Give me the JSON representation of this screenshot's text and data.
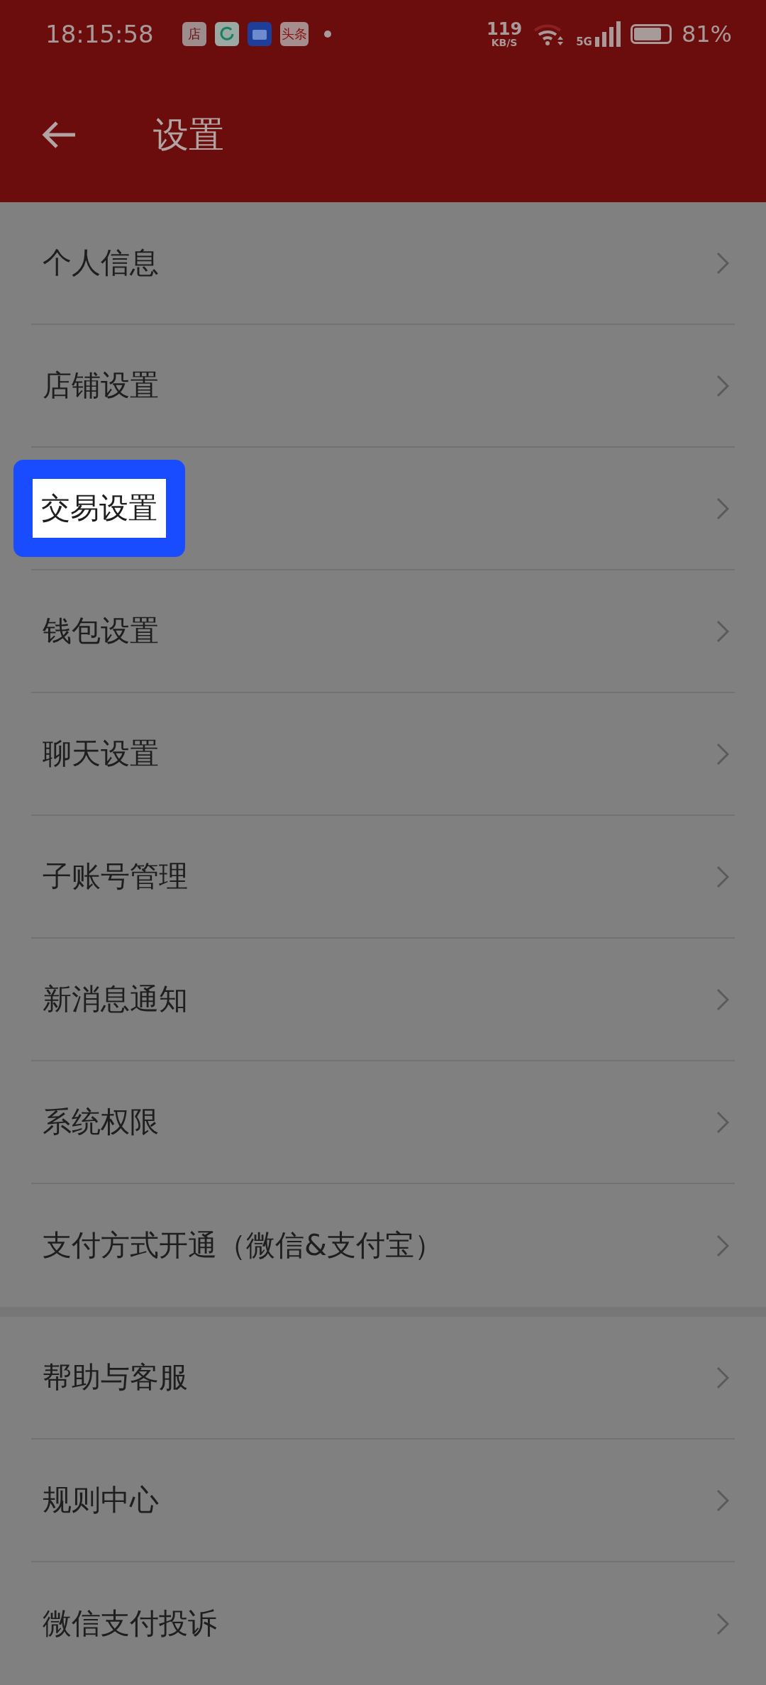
{
  "status_bar": {
    "time": "18:15:58",
    "app_badges": [
      {
        "label": "店",
        "kind": "shop"
      },
      {
        "kind": "refresh"
      },
      {
        "kind": "folder"
      },
      {
        "label": "头条",
        "kind": "news"
      }
    ],
    "speed": "119",
    "speed_unit": "KB/S",
    "network": "5G",
    "battery": "81%"
  },
  "header": {
    "title": "设置"
  },
  "groups": [
    {
      "items": [
        {
          "label": "个人信息",
          "highlighted": false
        },
        {
          "label": "店铺设置",
          "highlighted": false
        },
        {
          "label": "交易设置",
          "highlighted": true
        },
        {
          "label": "钱包设置",
          "highlighted": false
        },
        {
          "label": "聊天设置",
          "highlighted": false
        },
        {
          "label": "子账号管理",
          "highlighted": false
        },
        {
          "label": "新消息通知",
          "highlighted": false
        },
        {
          "label": "系统权限",
          "highlighted": false
        },
        {
          "label": "支付方式开通（微信&支付宝）",
          "highlighted": false
        }
      ]
    },
    {
      "items": [
        {
          "label": "帮助与客服",
          "highlighted": false
        },
        {
          "label": "规则中心",
          "highlighted": false
        },
        {
          "label": "微信支付投诉",
          "highlighted": false
        }
      ]
    }
  ]
}
